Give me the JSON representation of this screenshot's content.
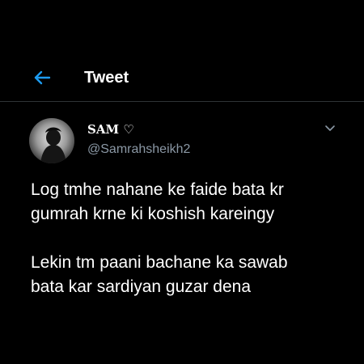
{
  "header": {
    "back_icon": "arrow-left-icon",
    "title": "Tweet"
  },
  "author": {
    "display_name": "SAM ♡",
    "handle": "@Samrahsheikh2",
    "avatar_icon": "avatar-silhouette"
  },
  "menu_icon": "chevron-down-icon",
  "tweet": {
    "paragraph_1_line_1": "Log tmhe nahane ke faide bata kr",
    "paragraph_1_line_2": "gumrah krne ki koshish kareingy",
    "paragraph_2_line_1": "Lekin tm paani bachane ka sawab",
    "paragraph_2_line_2": "bata kar sardiyan guzar dena"
  },
  "colors": {
    "background": "#000000",
    "accent": "#1d9bf0",
    "text": "#ffffff",
    "secondary_text": "#8b98a5",
    "divider": "#2f3336"
  }
}
